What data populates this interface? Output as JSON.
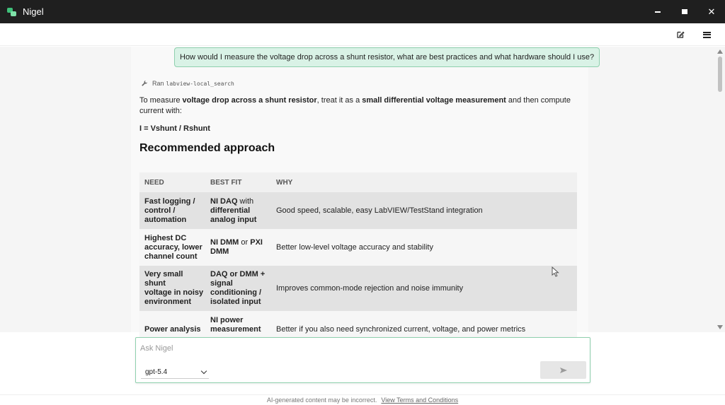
{
  "window": {
    "title": "Nigel",
    "controls": {
      "minimize": "minimize",
      "maximize": "maximize",
      "close": "✕"
    }
  },
  "toolbar": {
    "edit_icon": "edit-icon",
    "menu_icon": "hamburger-menu-icon"
  },
  "conversation": {
    "user_message": "How would I measure the voltage drop across a shunt resistor, what are best practices and what hardware should I use?",
    "tool_call": {
      "prefix": "Ran",
      "name": "labview-local_search"
    },
    "intro": {
      "t1": "To measure ",
      "b1": "voltage drop across a shunt resistor",
      "t2": ", treat it as a ",
      "b2": "small differential voltage measurement",
      "t3": " and then compute current with:"
    },
    "formula": "I = Vshunt / Rshunt",
    "heading": "Recommended approach",
    "table": {
      "headers": [
        "NEED",
        "BEST FIT",
        "WHY"
      ],
      "rows": [
        {
          "need": [
            "Fast logging /",
            "control /",
            "automation"
          ],
          "fit": [
            [
              "NI DAQ",
              " with"
            ],
            [
              "differential",
              ""
            ],
            [
              "analog input",
              ""
            ]
          ],
          "why": "Good speed, scalable, easy LabVIEW/TestStand integration"
        },
        {
          "need": [
            "Highest DC",
            "accuracy, lower",
            "channel count"
          ],
          "fit": [
            [
              "NI DMM",
              " or "
            ],
            [
              "PXI",
              ""
            ],
            [
              "DMM",
              ""
            ]
          ],
          "why": "Better low-level voltage accuracy and stability"
        },
        {
          "need": [
            "Very small shunt",
            "voltage in noisy",
            "environment"
          ],
          "fit": [
            [
              "DAQ or DMM +",
              ""
            ],
            [
              "signal",
              ""
            ],
            [
              "conditioning /",
              ""
            ],
            [
              "isolated input",
              ""
            ]
          ],
          "why": "Improves common-mode rejection and noise immunity"
        },
        {
          "need": [
            "Power analysis"
          ],
          "fit": [
            [
              "NI power",
              ""
            ],
            [
              "measurement",
              ""
            ]
          ],
          "why": "Better if you also need synchronized current, voltage, and power metrics"
        }
      ]
    }
  },
  "composer": {
    "placeholder": "Ask Nigel",
    "model": "gpt-5.4",
    "send_icon": "send-icon"
  },
  "footer": {
    "disclaimer": "AI-generated content may be incorrect.",
    "terms_link": "View Terms and Conditions"
  },
  "colors": {
    "titlebar": "#1f1f1f",
    "accent": "#8fd0ae",
    "user_bubble": "#d9f2e6",
    "table_alt_row": "#e2e2e2"
  }
}
